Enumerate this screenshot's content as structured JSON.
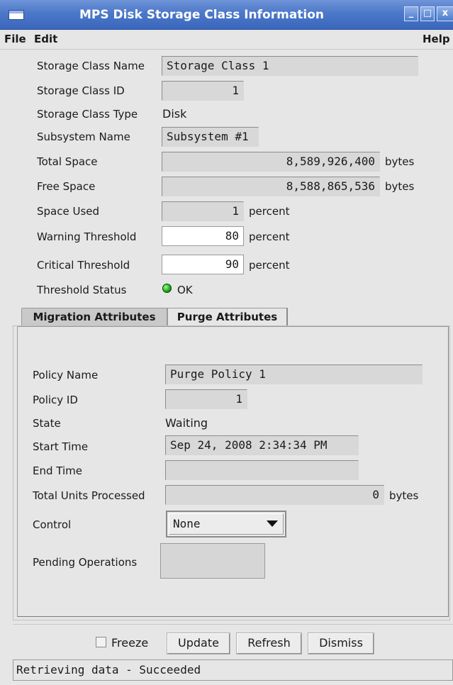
{
  "window": {
    "title": "MPS Disk Storage Class Information",
    "controls": {
      "minimize": "_",
      "maximize": "□",
      "close": "x"
    }
  },
  "menu": {
    "file": "File",
    "edit": "Edit",
    "help": "Help"
  },
  "storage_class": {
    "name_label": "Storage Class Name",
    "name_value": "Storage Class 1",
    "id_label": "Storage Class ID",
    "id_value": "1",
    "type_label": "Storage Class Type",
    "type_value": "Disk",
    "subsystem_label": "Subsystem Name",
    "subsystem_value": "Subsystem #1",
    "total_label": "Total Space",
    "total_value": "8,589,926,400",
    "total_unit": "bytes",
    "free_label": "Free Space",
    "free_value": "8,588,865,536",
    "free_unit": "bytes",
    "used_label": "Space Used",
    "used_value": "1",
    "used_unit": "percent",
    "warning_label": "Warning Threshold",
    "warning_value": "80",
    "warning_unit": "percent",
    "critical_label": "Critical Threshold",
    "critical_value": "90",
    "critical_unit": "percent",
    "status_label": "Threshold Status",
    "status_value": "OK",
    "status_color": "#1aa51a"
  },
  "tabs": {
    "migration": "Migration Attributes",
    "purge": "Purge Attributes",
    "active": "purge"
  },
  "purge": {
    "policy_name_label": "Policy Name",
    "policy_name_value": "Purge Policy 1",
    "policy_id_label": "Policy ID",
    "policy_id_value": "1",
    "state_label": "State",
    "state_value": "Waiting",
    "start_label": "Start Time",
    "start_value": "Sep 24, 2008 2:34:34 PM",
    "end_label": "End Time",
    "end_value": "",
    "units_label": "Total Units Processed",
    "units_value": "0",
    "units_unit": "bytes",
    "control_label": "Control",
    "control_value": "None",
    "pending_label": "Pending Operations"
  },
  "buttons": {
    "freeze": "Freeze",
    "update": "Update",
    "refresh": "Refresh",
    "dismiss": "Dismiss"
  },
  "status_bar": "Retrieving data - Succeeded",
  "colors": {
    "titlebar": "#4c78c8",
    "background": "#e6e6e6",
    "readonly_field": "#d8d8d8"
  }
}
